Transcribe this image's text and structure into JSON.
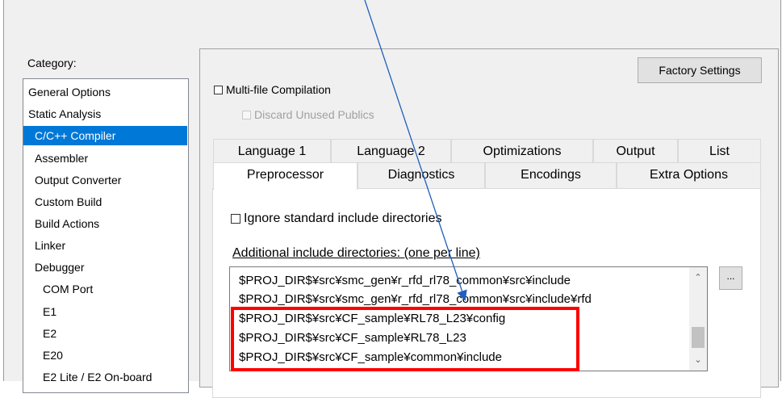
{
  "category": {
    "label": "Category:",
    "items": [
      {
        "label": "General Options"
      },
      {
        "label": "Static Analysis"
      },
      {
        "label": "C/C++ Compiler",
        "selected": true
      },
      {
        "label": "Assembler"
      },
      {
        "label": "Output Converter"
      },
      {
        "label": "Custom Build"
      },
      {
        "label": "Build Actions"
      },
      {
        "label": "Linker"
      },
      {
        "label": "Debugger"
      },
      {
        "label": "COM Port"
      },
      {
        "label": "E1"
      },
      {
        "label": "E2"
      },
      {
        "label": "E20"
      },
      {
        "label": "E2 Lite / E2 On-board"
      }
    ]
  },
  "factory_settings": "Factory Settings",
  "multi_file": "Multi-file Compilation",
  "discard_unused": "Discard Unused Publics",
  "tabs_row1": [
    "Language 1",
    "Language 2",
    "Optimizations",
    "Output",
    "List"
  ],
  "tabs_row2": [
    "Preprocessor",
    "Diagnostics",
    "Encodings",
    "Extra Options"
  ],
  "ignore_std": "Ignore standard include directories",
  "additional_label": "Additional include directories: (one per line)",
  "include_dirs": [
    "$PROJ_DIR$¥src¥smc_gen¥r_rfd_rl78_common¥src¥include",
    "$PROJ_DIR$¥src¥smc_gen¥r_rfd_rl78_common¥src¥include¥rfd",
    "$PROJ_DIR$¥src¥CF_sample¥RL78_L23¥config",
    "$PROJ_DIR$¥src¥CF_sample¥RL78_L23",
    "$PROJ_DIR$¥src¥CF_sample¥common¥include"
  ],
  "browse_button": "...",
  "colors": {
    "selection": "#0078d7",
    "highlight": "#ff0000",
    "arrow": "#1f5fbf"
  }
}
